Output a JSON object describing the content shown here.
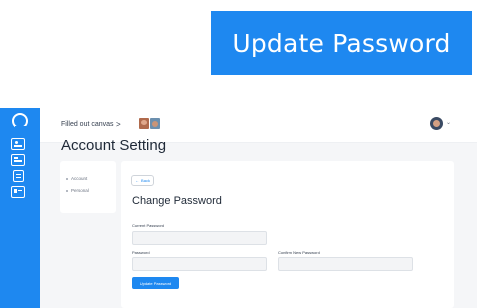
{
  "zoom_callout": {
    "label": "Update Password"
  },
  "colors": {
    "accent": "#1e88f0",
    "background": "#f5f6f8",
    "card": "#ffffff"
  },
  "rail": {
    "icons": [
      "logo-icon",
      "image-icon",
      "board-icon",
      "clipboard-icon",
      "contact-card-icon"
    ]
  },
  "topbar": {
    "breadcrumb": "Filled out canvas",
    "breadcrumb_separator": ">"
  },
  "page": {
    "title": "Account Setting"
  },
  "sidebar": {
    "items": [
      {
        "label": "Account"
      },
      {
        "label": "Personal"
      }
    ]
  },
  "form": {
    "back_label": "Back",
    "title": "Change Password",
    "current_password_label": "Current Password",
    "current_password_value": "",
    "password_label": "Password",
    "password_value": "",
    "confirm_label": "Confirm New Password",
    "confirm_value": "",
    "submit_label": "Update Password"
  }
}
